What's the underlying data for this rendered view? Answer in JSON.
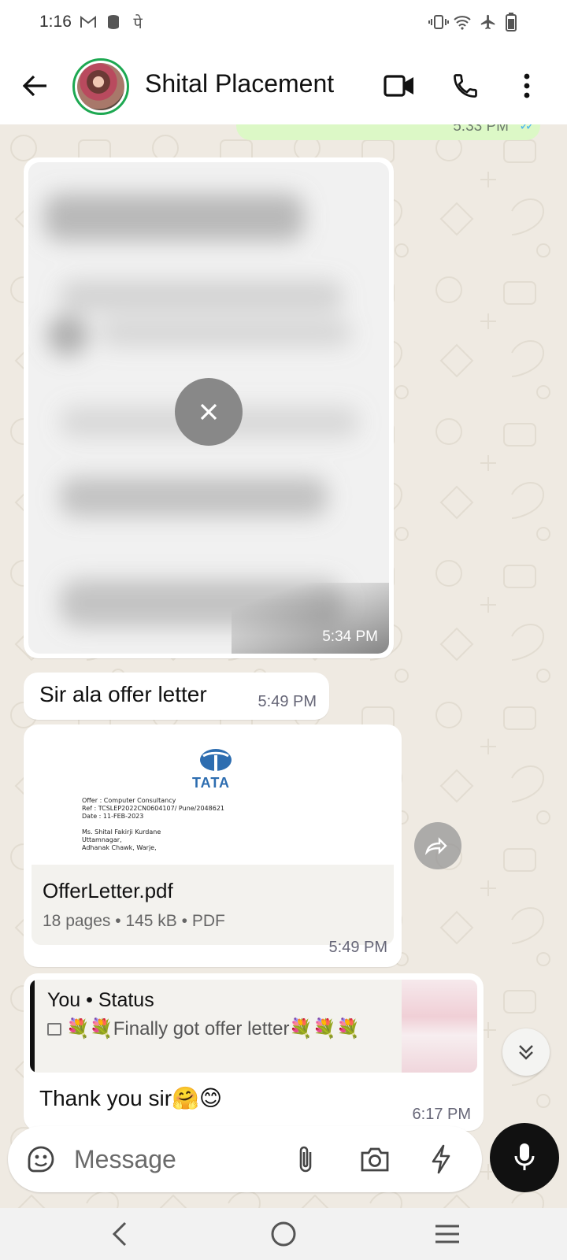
{
  "status_bar": {
    "time": "1:16"
  },
  "header": {
    "contact_name": "Shital Placement",
    "icons": [
      "back-arrow-icon",
      "video-call-icon",
      "voice-call-icon",
      "more-options-icon"
    ]
  },
  "messages": {
    "previous_out": {
      "time": "5:33 PM"
    },
    "image": {
      "time": "5:34 PM"
    },
    "text1": {
      "text": "Sir ala offer letter",
      "time": "5:49 PM"
    },
    "document": {
      "preview_brand": "TATA",
      "preview_lines": [
        "Offer  : Computer Consultancy",
        "Ref    : TCSLEP2022CN0604107/ Pune/2048621",
        "Date   : 11-FEB-2023",
        "Ms. Shital Fakirji Kurdane",
        "Uttamnagar,",
        "Adhanak Chawk, Warje,"
      ],
      "file_name": "OfferLetter.pdf",
      "meta": "18 pages • 145 kB • PDF",
      "time": "5:49 PM"
    },
    "reply": {
      "quote_author": "You • Status",
      "quote_text": "💐💐Finally got offer letter💐💐💐",
      "text": "Thank you sir🤗😊",
      "time": "6:17 PM"
    }
  },
  "composer": {
    "placeholder": "Message"
  },
  "colors": {
    "accent_green": "#1da851",
    "chat_bg": "#efeae2",
    "outgoing_bubble": "#dcf8c6",
    "read_tick": "#4fb6ec"
  }
}
